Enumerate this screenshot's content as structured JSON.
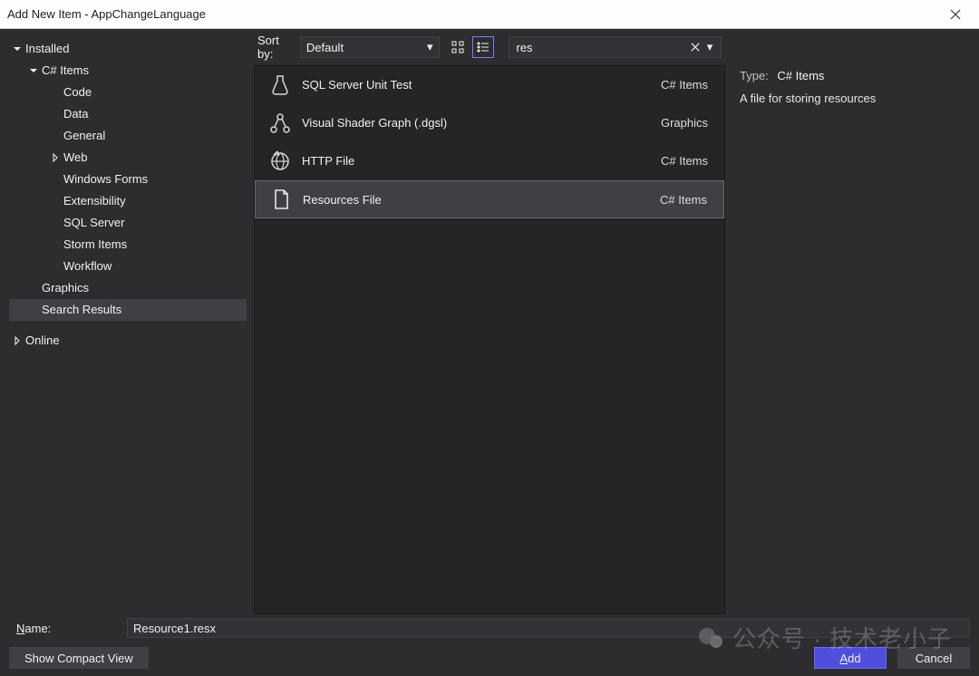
{
  "window": {
    "title": "Add New Item - AppChangeLanguage"
  },
  "sidebar": {
    "items": [
      {
        "label": "Installed",
        "level": 0,
        "expanded": true
      },
      {
        "label": "C# Items",
        "level": 1,
        "expanded": true
      },
      {
        "label": "Code",
        "level": 2
      },
      {
        "label": "Data",
        "level": 2
      },
      {
        "label": "General",
        "level": 2
      },
      {
        "label": "Web",
        "level": 2,
        "collapsed": true
      },
      {
        "label": "Windows Forms",
        "level": 2
      },
      {
        "label": "Extensibility",
        "level": 2
      },
      {
        "label": "SQL Server",
        "level": 2
      },
      {
        "label": "Storm Items",
        "level": 2
      },
      {
        "label": "Workflow",
        "level": 2
      },
      {
        "label": "Graphics",
        "level": 1
      },
      {
        "label": "Search Results",
        "level": 1,
        "selected": true
      },
      {
        "label": "Online",
        "level": 0,
        "collapsed": true
      }
    ]
  },
  "toolbar": {
    "sort_label": "Sort by:",
    "sort_value": "Default"
  },
  "search": {
    "value": "res"
  },
  "templates": [
    {
      "name": "SQL Server Unit Test",
      "category": "C# Items",
      "icon": "flask"
    },
    {
      "name": "Visual Shader Graph (.dgsl)",
      "category": "Graphics",
      "icon": "graph"
    },
    {
      "name": "HTTP File",
      "category": "C# Items",
      "icon": "globe"
    },
    {
      "name": "Resources File",
      "category": "C# Items",
      "icon": "file",
      "selected": true
    }
  ],
  "detail": {
    "type_label": "Type:",
    "type_value": "C# Items",
    "description": "A file for storing resources"
  },
  "footer": {
    "name_label": "Name:",
    "name_value": "Resource1.resx",
    "compact_button": "Show Compact View",
    "add_button": "Add",
    "cancel_button": "Cancel"
  },
  "watermark": {
    "text": "公众号 · 技术老小子"
  }
}
